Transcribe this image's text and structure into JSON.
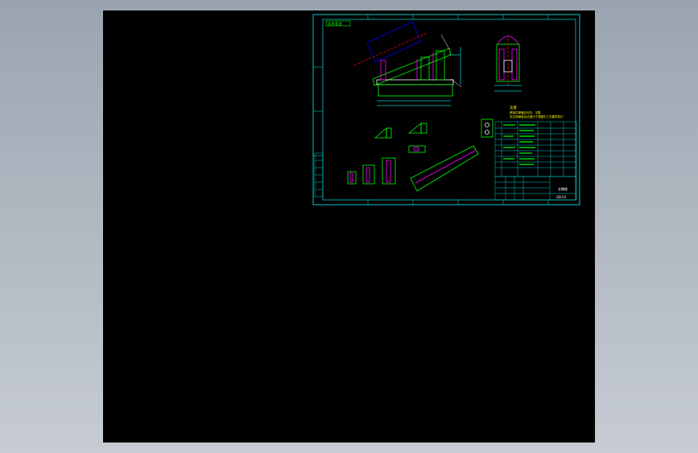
{
  "viewer": {
    "background_outer": "#a8b0ba",
    "canvas_color": "#000000"
  },
  "drawing": {
    "frame_color": "#00c8c8",
    "line_color": "#00ff00",
    "alt_color": "#ffff00",
    "accent_red": "#ff0000",
    "accent_blue": "#0000ff",
    "accent_magenta": "#ff00ff",
    "top_label": "技术要求",
    "notes_title": "注意",
    "notes_lines": [
      "焊接件焊缝应均匀、平整",
      "未注明倒角及过渡尺寸按图中工艺要求执行"
    ],
    "zone_top": [
      "1",
      "2",
      "3",
      "4",
      "5",
      "6"
    ],
    "title_name": "支撑座",
    "title_code": "GB-01"
  }
}
